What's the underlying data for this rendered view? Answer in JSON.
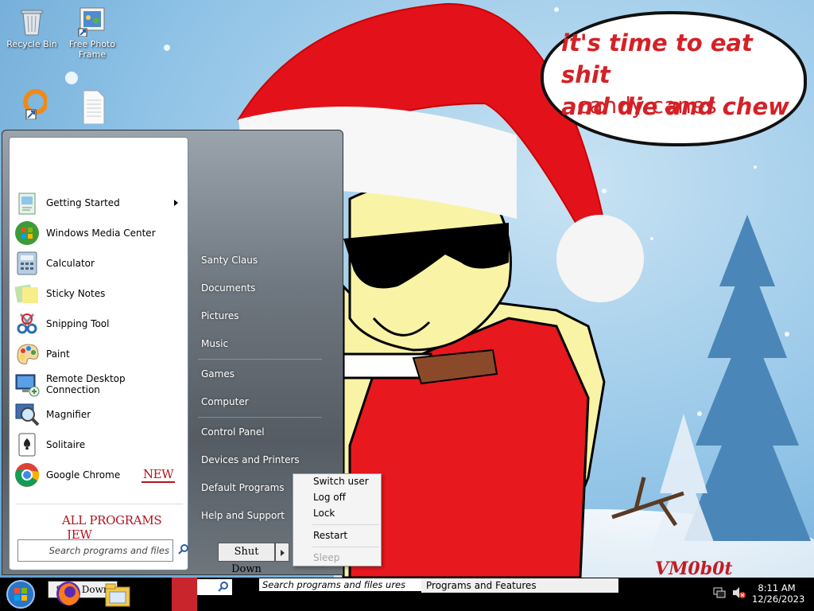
{
  "desktop": {
    "icons": [
      {
        "name": "recycle-bin",
        "label": "Recycle Bin"
      },
      {
        "name": "free-photo-frame",
        "label": "Free Photo Frame"
      },
      {
        "name": "ring-shortcut",
        "label": ""
      },
      {
        "name": "text-document",
        "label": ""
      }
    ],
    "wallpaper": {
      "bubble_line1": "it's time to eat shit",
      "bubble_line2": "and die and chew",
      "bubble_line3": "candy canes",
      "signature": "VM0b0t"
    }
  },
  "start_menu": {
    "programs": [
      {
        "label": "Getting Started",
        "icon": "getting-started-icon",
        "submenu": true
      },
      {
        "label": "Windows Media Center",
        "icon": "media-center-icon"
      },
      {
        "label": "Calculator",
        "icon": "calculator-icon"
      },
      {
        "label": "Sticky Notes",
        "icon": "sticky-notes-icon"
      },
      {
        "label": "Snipping Tool",
        "icon": "snipping-tool-icon"
      },
      {
        "label": "Paint",
        "icon": "paint-icon"
      },
      {
        "label": "Remote Desktop Connection",
        "icon": "remote-desktop-icon"
      },
      {
        "label": "Magnifier",
        "icon": "magnifier-icon"
      },
      {
        "label": "Solitaire",
        "icon": "solitaire-icon"
      },
      {
        "label": "Google Chrome",
        "icon": "chrome-icon",
        "badge": "NEW"
      }
    ],
    "all_programs": "ALL PROGRAMS",
    "all_programs_badge": "JEW",
    "search_placeholder": "Search programs and files",
    "right_items": [
      "Santy Claus",
      "Documents",
      "Pictures",
      "Music",
      "Games",
      "Computer",
      "Control Panel",
      "Devices and Printers",
      "Default Programs",
      "Help and Support"
    ],
    "shutdown_label": "Shut Down"
  },
  "shutdown_menu": {
    "items": [
      "Switch user",
      "Log off",
      "Lock",
      "Restart",
      "Sleep"
    ]
  },
  "taskbar": {
    "search_text": "Search programs and files ures",
    "features_text": "Programs and Features",
    "glitch_label": "Shut Down",
    "time": "8:11 AM",
    "date": "12/26/2023"
  },
  "colors": {
    "accent_red": "#b2141d",
    "bubble_text": "#d42127",
    "taskbar": "#000000"
  }
}
